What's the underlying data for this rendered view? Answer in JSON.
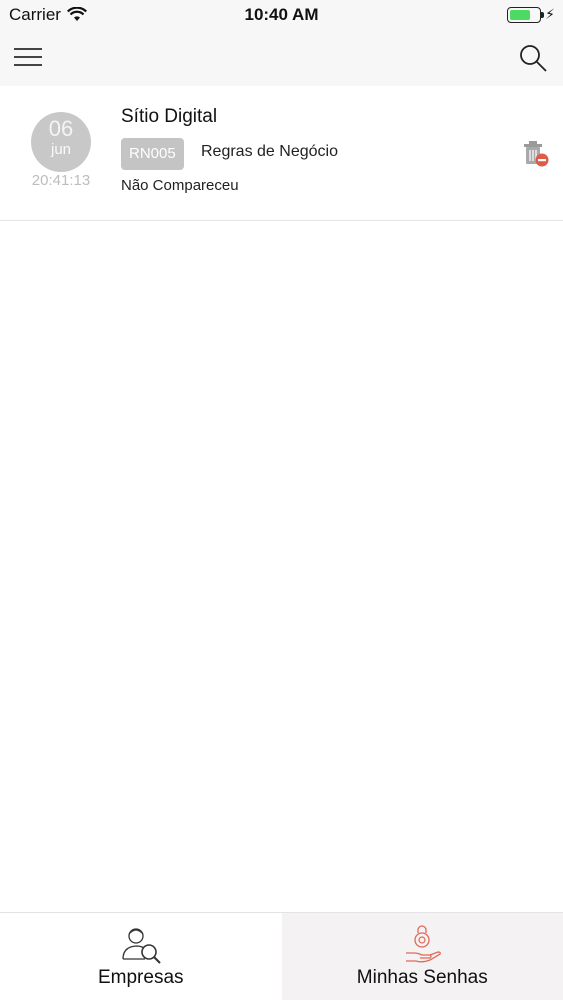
{
  "status_bar": {
    "carrier": "Carrier",
    "time": "10:40 AM",
    "battery_color": "#4cd964"
  },
  "nav": {
    "menu_icon": "hamburger-menu-icon",
    "search_icon": "search-icon"
  },
  "tickets": [
    {
      "day": "06",
      "month": "jun",
      "time": "20:41:13",
      "company": "Sítio Digital",
      "code": "RN005",
      "service": "Regras de Negócio",
      "status": "Não Compareceu",
      "delete_icon": "trash-remove-icon"
    }
  ],
  "tabs": [
    {
      "label": "Empresas",
      "icon": "company-search-icon",
      "selected": false
    },
    {
      "label": "Minhas Senhas",
      "icon": "hand-ticket-icon",
      "selected": true,
      "accent": "#e0685a"
    }
  ]
}
